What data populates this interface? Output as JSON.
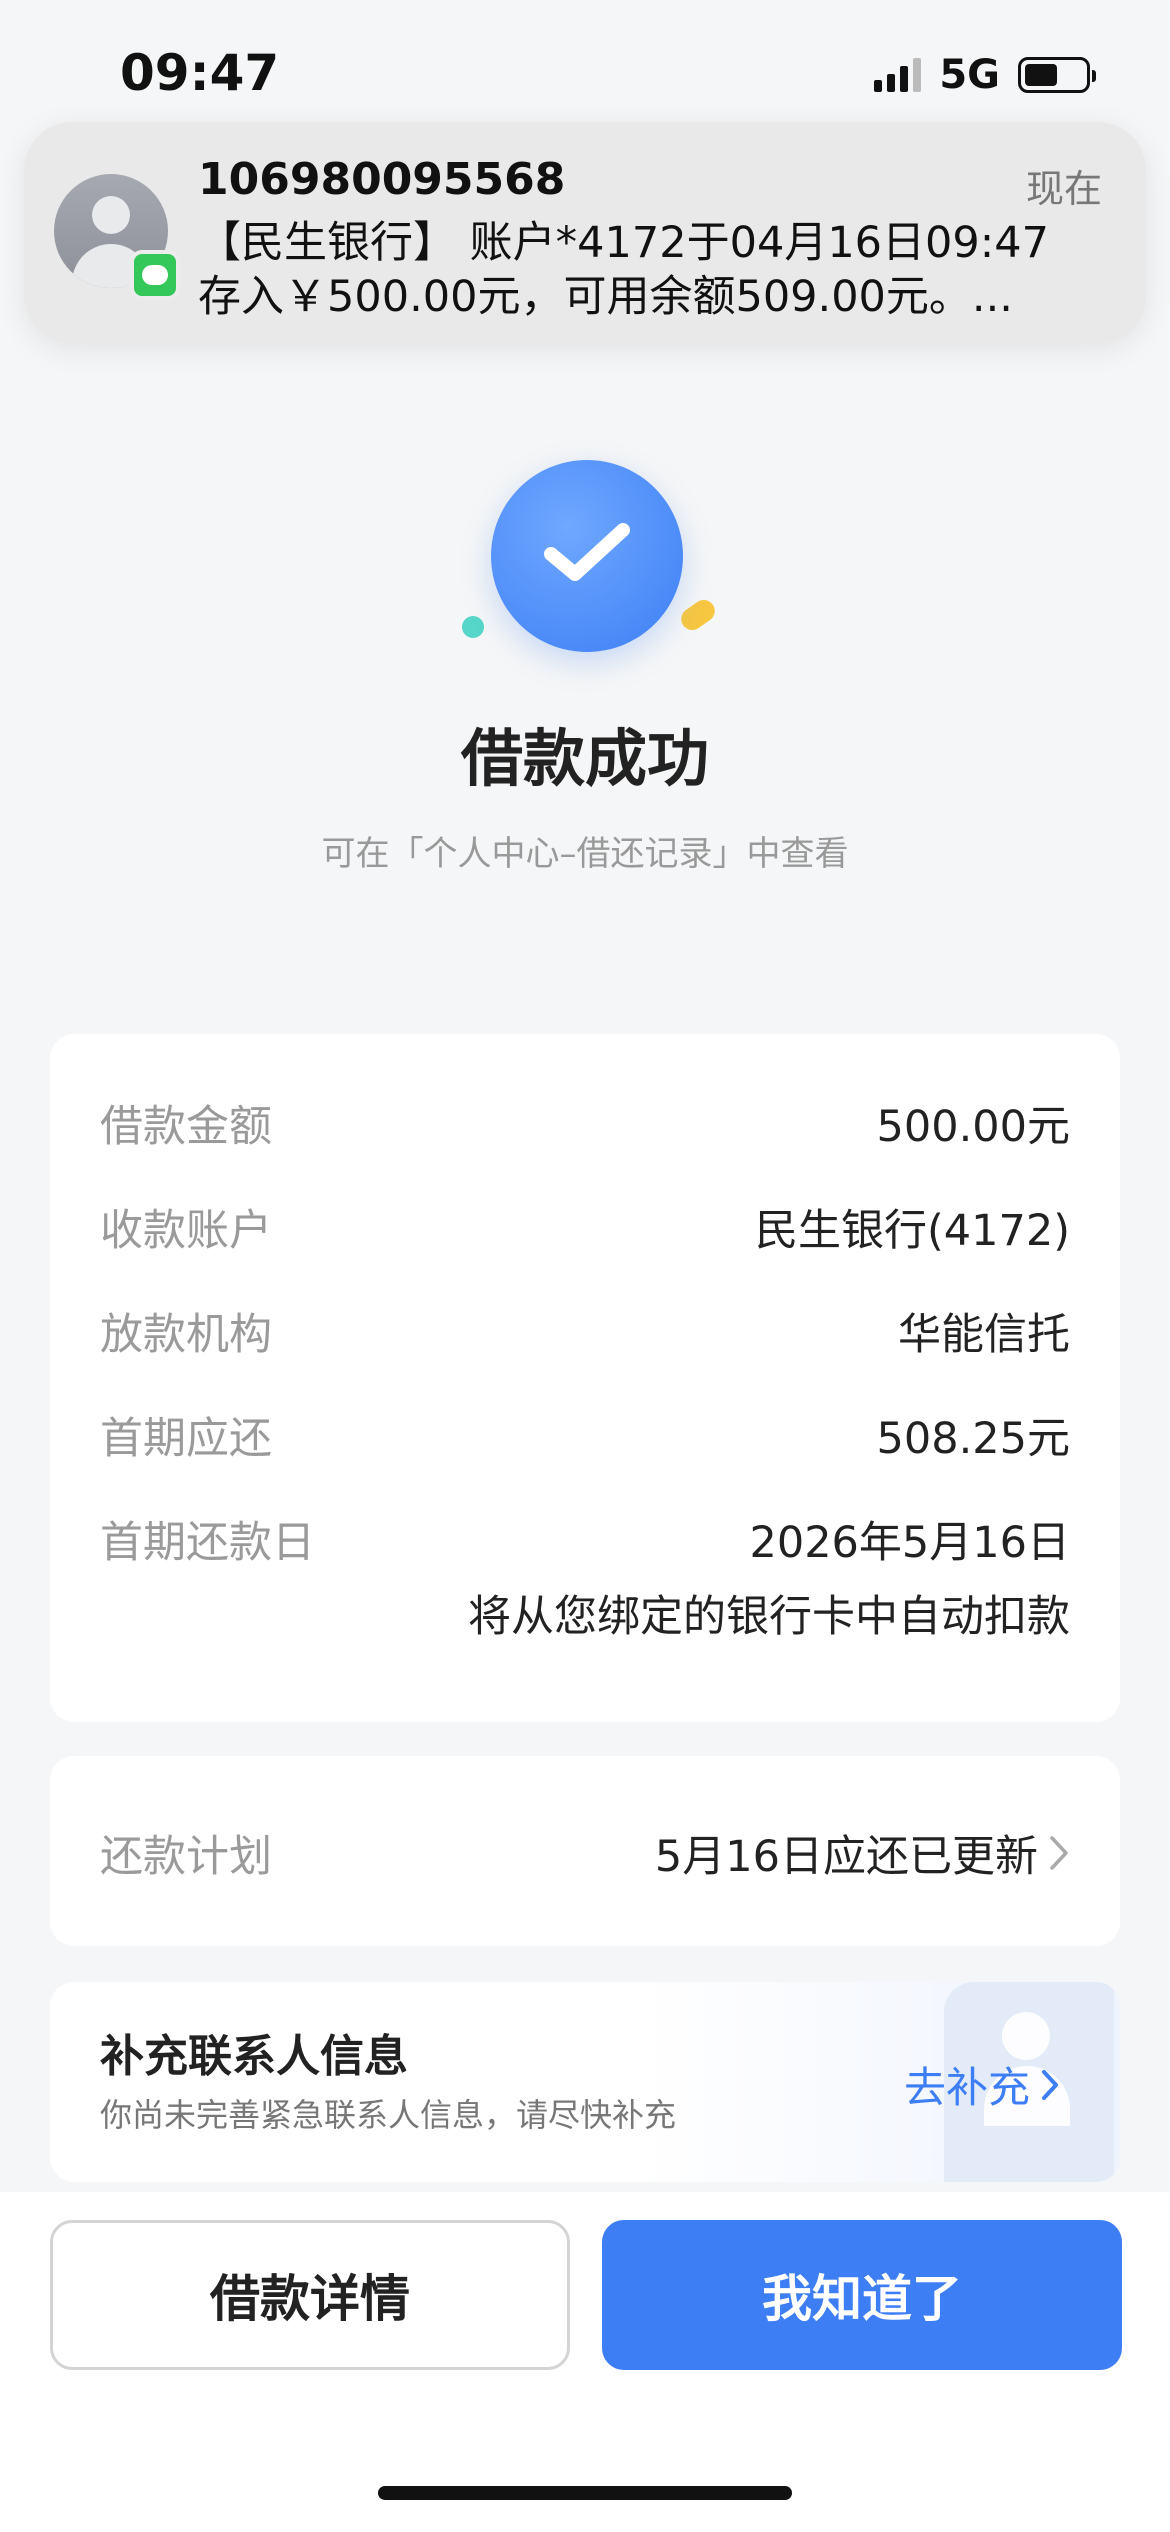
{
  "status_bar": {
    "time": "09:47",
    "network": "5G"
  },
  "notification": {
    "sender": "106980095568",
    "time": "现在",
    "line1": "【民生银行】 账户*4172于04月16日09:47",
    "line2": "存入￥500.00元，可用余额509.00元。..."
  },
  "success": {
    "title": "借款成功",
    "subtitle": "可在「个人中心–借还记录」中查看"
  },
  "details": {
    "rows": [
      {
        "label": "借款金额",
        "value": "500.00元"
      },
      {
        "label": "收款账户",
        "value": "民生银行(4172)"
      },
      {
        "label": "放款机构",
        "value": "华能信托"
      },
      {
        "label": "首期应还",
        "value": "508.25元"
      },
      {
        "label": "首期还款日",
        "value": "2026年5月16日"
      }
    ],
    "note": "将从您绑定的银行卡中自动扣款"
  },
  "plan": {
    "label": "还款计划",
    "value": "5月16日应还已更新"
  },
  "contact": {
    "title": "补充联系人信息",
    "subtitle": "你尚未完善紧急联系人信息，请尽快补充",
    "link": "去补充"
  },
  "buttons": {
    "detail": "借款详情",
    "ok": "我知道了"
  },
  "colors": {
    "accent": "#3d7ef5",
    "background": "#f5f6f7"
  }
}
